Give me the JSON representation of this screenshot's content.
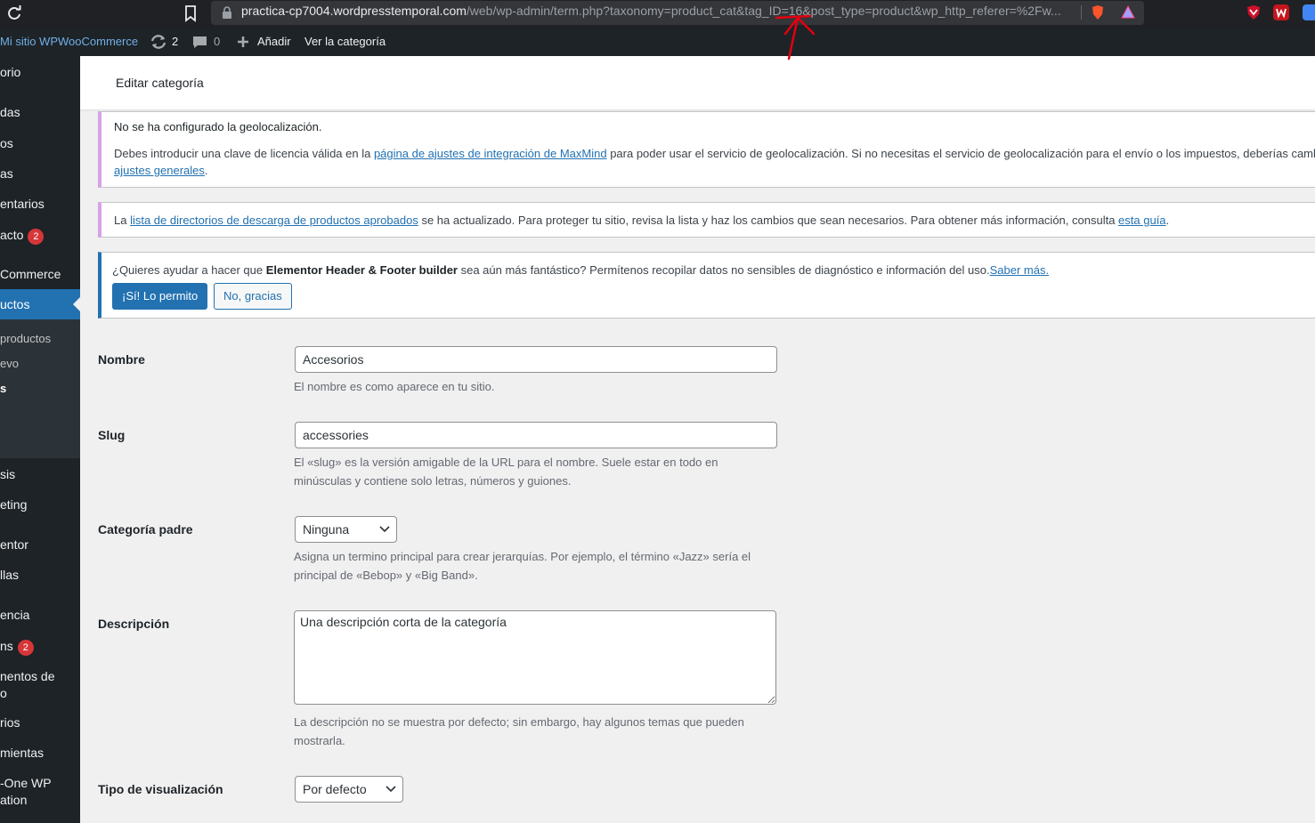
{
  "browser": {
    "url_host": "practica-cp7004.wordpresstemporal.com",
    "url_path": "/web/wp-admin/term.php?taxonomy=product_cat&tag_ID=16&post_type=product&wp_http_referer=%2Fw..."
  },
  "adminbar": {
    "site_name": "Mi sitio WPWooCommerce",
    "updates_count": "2",
    "comments_count": "0",
    "add_new": "Añadir",
    "view_category": "Ver la categoría"
  },
  "sidebar": {
    "items": [
      {
        "label": "orio"
      },
      {
        "label": "das"
      },
      {
        "label": "os"
      },
      {
        "label": "as"
      },
      {
        "label": "entarios"
      },
      {
        "label": "acto",
        "badge": "2"
      },
      {
        "label": "Commerce"
      },
      {
        "label": "uctos"
      },
      {
        "label": "productos"
      },
      {
        "label": "evo"
      },
      {
        "label": "s"
      },
      {
        "label": "sis"
      },
      {
        "label": "eting"
      },
      {
        "label": "entor"
      },
      {
        "label": "llas"
      },
      {
        "label": "encia"
      },
      {
        "label": "ns",
        "badge": "2"
      },
      {
        "label": "nentos de"
      },
      {
        "label": "o"
      },
      {
        "label": "rios"
      },
      {
        "label": "mientas"
      },
      {
        "label": "-One WP"
      },
      {
        "label": "ation"
      }
    ]
  },
  "page": {
    "title": "Editar categoría"
  },
  "notices": {
    "geo_title": "No se ha configurado la geolocalización.",
    "geo_text_before": "Debes introducir una clave de licencia válida en la ",
    "geo_link": "página de ajustes de integración de MaxMind",
    "geo_text_after": " para poder usar el servicio de geolocalización. Si no necesitas el servicio de geolocalización para el envío o los impuestos, deberías cambiar",
    "geo_link2": "ajustes generales",
    "geo_end": ".",
    "dl_before": "La ",
    "dl_link": "lista de directorios de descarga de productos aprobados",
    "dl_middle": " se ha actualizado. Para proteger tu sitio, revisa la lista y haz los cambios que sean necesarios. Para obtener más información, consulta ",
    "dl_link2": "esta guía",
    "dl_end": ".",
    "el_before": "¿Quieres ayudar a hacer que ",
    "el_bold": "Elementor Header & Footer builder",
    "el_after": " sea aún más fantástico? Permítenos recopilar datos no sensibles de diagnóstico e información del uso.",
    "el_link": "Saber más.",
    "allow_button": "¡Sí! Lo permito",
    "deny_button": "No, gracias"
  },
  "form": {
    "name_label": "Nombre",
    "name_value": "Accesorios",
    "name_help": "El nombre es como aparece en tu sitio.",
    "slug_label": "Slug",
    "slug_value": "accessories",
    "slug_help": "El «slug» es la versión amigable de la URL para el nombre. Suele estar en todo en minúsculas y contiene solo letras, números y guiones.",
    "parent_label": "Categoría padre",
    "parent_value": "Ninguna",
    "parent_help": "Asigna un termino principal para crear jerarquías. Por ejemplo, el término «Jazz» sería el principal de «Bebop» y «Big Band».",
    "desc_label": "Descripción",
    "desc_value": "Una descripción corta de la categoría",
    "desc_help": "La descripción no se muestra por defecto; sin embargo, hay algunos temas que pueden mostrarla.",
    "display_label": "Tipo de visualización",
    "display_value": "Por defecto"
  },
  "colors": {
    "admin_dark": "#1d2327",
    "wp_blue": "#2271b1",
    "notice_purple": "#d6a2e8",
    "annotation_red": "#e3000f"
  }
}
